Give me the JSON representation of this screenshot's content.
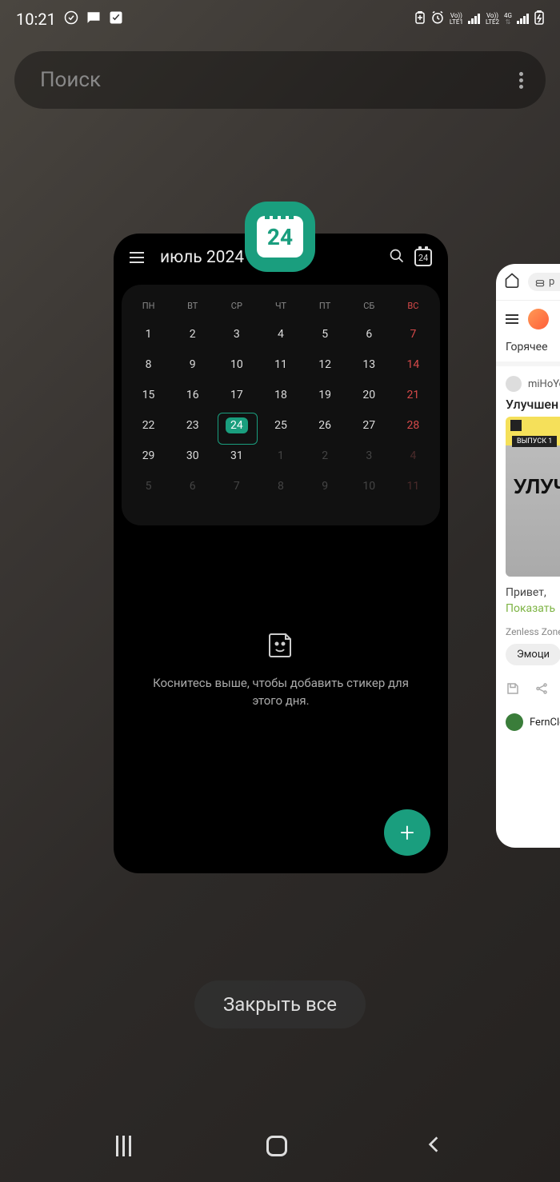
{
  "status": {
    "time": "10:21",
    "lte1": "LTE1",
    "lte2": "LTE2",
    "net": "4G",
    "volte": "Vo))"
  },
  "search": {
    "placeholder": "Поиск"
  },
  "app_icon": {
    "day": "24"
  },
  "calendar": {
    "title": "июль 2024",
    "today_badge": "24",
    "dow": [
      "ПН",
      "ВТ",
      "СР",
      "ЧТ",
      "ПТ",
      "СБ",
      "ВС"
    ],
    "weeks": [
      [
        {
          "n": "1"
        },
        {
          "n": "2"
        },
        {
          "n": "3"
        },
        {
          "n": "4"
        },
        {
          "n": "5"
        },
        {
          "n": "6"
        },
        {
          "n": "7",
          "sun": true
        }
      ],
      [
        {
          "n": "8"
        },
        {
          "n": "9"
        },
        {
          "n": "10"
        },
        {
          "n": "11"
        },
        {
          "n": "12"
        },
        {
          "n": "13"
        },
        {
          "n": "14",
          "sun": true
        }
      ],
      [
        {
          "n": "15"
        },
        {
          "n": "16"
        },
        {
          "n": "17"
        },
        {
          "n": "18"
        },
        {
          "n": "19"
        },
        {
          "n": "20"
        },
        {
          "n": "21",
          "sun": true
        }
      ],
      [
        {
          "n": "22"
        },
        {
          "n": "23"
        },
        {
          "n": "24",
          "today": true
        },
        {
          "n": "25"
        },
        {
          "n": "26"
        },
        {
          "n": "27"
        },
        {
          "n": "28",
          "sun": true
        }
      ],
      [
        {
          "n": "29"
        },
        {
          "n": "30"
        },
        {
          "n": "31"
        },
        {
          "n": "1",
          "other": true
        },
        {
          "n": "2",
          "other": true
        },
        {
          "n": "3",
          "other": true
        },
        {
          "n": "4",
          "other": true,
          "sun": true
        }
      ],
      [
        {
          "n": "5",
          "other": true
        },
        {
          "n": "6",
          "other": true
        },
        {
          "n": "7",
          "other": true
        },
        {
          "n": "8",
          "other": true
        },
        {
          "n": "9",
          "other": true
        },
        {
          "n": "10",
          "other": true
        },
        {
          "n": "11",
          "other": true,
          "sun": true
        }
      ]
    ],
    "sticker_hint": "Коснитесь выше, чтобы добавить стикер для этого дня."
  },
  "browser": {
    "url_prefix": "p",
    "tab_hot": "Горячее",
    "poster": "miHoYo",
    "title": "Улучшен",
    "img_badge": "ВЫПУСК 1",
    "img_text1": "УЛУЧ",
    "body": "Привет, ",
    "show": "Показать",
    "meta": "Zenless Zone",
    "chip": "Эмоци",
    "next_user": "FernClo"
  },
  "close_all": "Закрыть все"
}
